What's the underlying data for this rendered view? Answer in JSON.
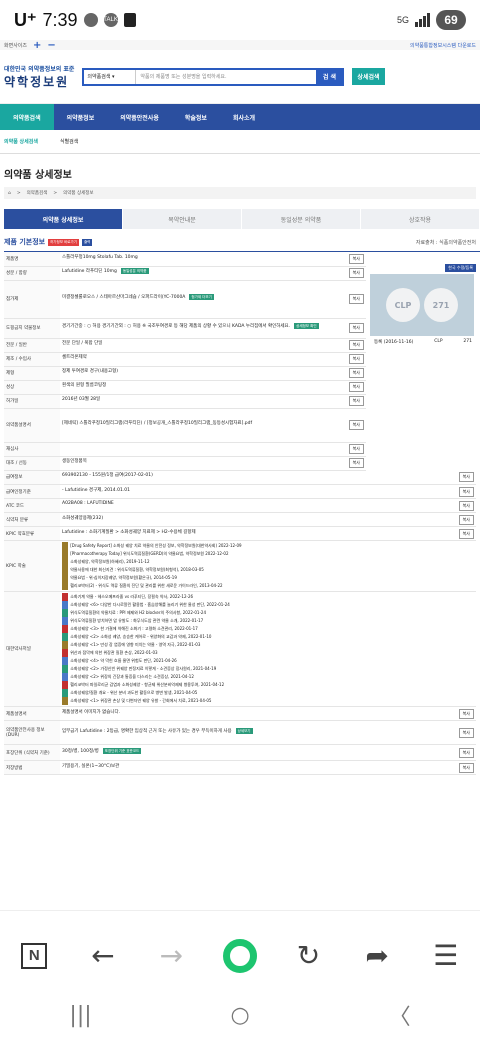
{
  "status": {
    "carrier": "U⁺",
    "time": "7:39",
    "badge": "TALK",
    "net": "5G",
    "battery": "69"
  },
  "browser": {
    "tab": "화면사이즈",
    "plus": "+",
    "minus": "−",
    "right": "의약품통합정보시스템 다운로드"
  },
  "header": {
    "slogan": "대한민국 의약품정보의 표준",
    "title": "약학정보원",
    "search_select": "의약품검색 ▾",
    "search_placeholder": "약품의 제품명 또는 성분명을 입력하세요.",
    "search_btn": "검 색",
    "detail_btn": "상세검색"
  },
  "gnb": [
    "의약품검색",
    "의약품정보",
    "의약품안전사용",
    "학술정보",
    "회사소개"
  ],
  "subnav": [
    "의약품 상세검색",
    "식별검색"
  ],
  "page_title": "의약품 상세정보",
  "breadcrumb": [
    "⌂",
    ">",
    "의약품검색",
    ">",
    "의약품 상세정보"
  ],
  "tabs": [
    "의약품 상세정보",
    "복약안내문",
    "동일성분 의약품",
    "상호작용"
  ],
  "section": {
    "title": "제품 기본정보",
    "badge1": "허가정보 바로가기",
    "badge2": "출력",
    "source": "자료출처 : 식품의약품안전처"
  },
  "view_label": "복사",
  "rows": [
    {
      "h": "제품명",
      "v": "스톨라푸정10mg Stolafu Tab. 10mg"
    },
    {
      "h": "성분 / 함량",
      "v": "Lafutidine  라푸티딘  10mg",
      "extra": "동일성분 의약품"
    },
    {
      "h": "첨가제",
      "v": "미결정셀룰로오스 / 스테아르산마그네슘 / 오파드라이(YC-7000A",
      "extra": "첨가제 더보기"
    },
    {
      "h": "도핑금지 약물정보",
      "v": "경기기간중 : ○ 허용   경기기간외 : ○ 허용  ※ 국조투여경로 등 해당 제품의 상황 수 있으니 KADA 누리집에서 확인하세요.",
      "extra": "상세정보 확인"
    },
    {
      "h": "전문 / 일반",
      "v": "전문   단일 / 복합   단일"
    },
    {
      "h": "제조 / 수입사",
      "v": "셀트리온제약"
    },
    {
      "h": "제형",
      "v": "정제   투여경로   경구(내용고형)"
    },
    {
      "h": "성상",
      "v": "흰색의 원형 필름코팅정"
    },
    {
      "h": "허가일",
      "v": "2016년 03월 28일"
    },
    {
      "h": "의약품설명서",
      "v": "[제네릭] 스톨라푸정10밀리그램(라푸티딘) / [정보공개_스톨라푸정10밀리그램_동등성시험자료].pdf"
    },
    {
      "h": "재심사",
      "v": ""
    },
    {
      "h": "대조 / 선동",
      "v": "생동인정품목"
    },
    {
      "h": "급여정보",
      "v": "693902130 - 155원/1정 급여(2017-02-01)"
    },
    {
      "h": "급여인정기준",
      "v": "- Lafutidine 경구제, 2014.01.01"
    },
    {
      "h": "ATC 코드",
      "v": "A02BA08 : LAFUTIDINE"
    },
    {
      "h": "식약처 분류",
      "v": "소화성궤양용제(232)"
    },
    {
      "h": "KPIC 약효분류",
      "v": "Lafutidine : 소화기계질환 > 소화성궤양 치료제 > H2-수용체 길항제"
    }
  ],
  "kpic": [
    "[Drug Safety Report] 소화성 궤양 치료 약물의 안전성 정보, 약학정보원(대한약사회) 2022-12-09",
    "[Pharmacotherapy Today] 위식도역류질환(GERD)의 약물요법, 약학정보원 2022-12-02",
    "소화성궤양, 약학정보원(하혜리), 2019-11-12",
    "약물사용에 대한 최신지견 : 위식도역류질환, 약학정보원(최형석), 2018-03-05",
    "약물요법 - 위·십이지장궤양, 약학정보원(황은규), 2014-05-19",
    "헬리코박터(2) - 위식도 역류 질환의 진단 및 관리를 위한 새로운 가이드라인, 2013-04-22"
  ],
  "news": [
    "소화기계 약물 - 헤스오메프라졸 vs 라푸티딘, 장필숙 약사, 2022-12-26",
    "소화성궤양 <6> 다양한 다시로알린 활용법 - 흡습양해를 늘리기 위한 물성 판단, 2022-01-24",
    "위식도역류질환의 약물치료 : PPI 제제와 H2 blocker의 주의사항, 2022-01-24",
    "위식도역류질환 방치하면 암 유발도 : 화무식도암 관련 약물 소개, 2022-01-17",
    "소화성궤양 <3> 한 가결에 약해진 소화기 : 고령화 소견관리, 2022-01-17",
    "소화성궤양 <2> 소화성 궤양, 승승한 케어로 - 위양화의 교감과 약제, 2022-01-10",
    "소화성궤양 <1> 만성 장 염증에 영향 미치는 약물 - 영역 자극, 2022-01-03",
    "위산과 점막에 의한 위장관 질환 손상, 2022-01-03",
    "소화성궤양 <4> 약 막힌 흐름 물면 위험도 판단, 2021-04-26",
    "소화성궤양 <2> 가정신빈 위궤양 판정지료 이렇게 - 소견증상 장사원리, 2021-04-19",
    "소화성궤양 <2> 위장의 긴장과 통증을 다스리는 소견증상, 2021-04-12",
    "헬리코박터 파일로리균 감염과 소화성궤양 - 항균제 위산분비억제제 병용투여, 2021-04-12",
    "소화성궤양/질환 개요 - 위산 분비 과도한 활동으로 병변 발생, 2021-04-05",
    "소화성궤양 <1> 위장관 손상 및 다변자연 궤양 유발 - 간회에서 치료, 2021-04-05"
  ],
  "rows2": [
    {
      "h": "제품설명서",
      "v": "제품설명서 이미지가 없습니다."
    },
    {
      "h": "의약품안전사용 정보(DUR)",
      "v": "임부금기 Lafutidine : 2등급, 명확한 임상적 근거 또는 사유가 있는 경우 부득이하게 사용",
      "extra": "상세보기"
    },
    {
      "h": "포장단위 (식약처 기준)",
      "v": "30정/병, 100정/병",
      "extra": "포장단위 기준 표준코드"
    },
    {
      "h": "저장방법",
      "v": "기밀용기, 실온(1~30°C)보관"
    }
  ],
  "kpic_label": "KPIC 학술",
  "news_label": "대한약사저널",
  "side": {
    "btn": "한국 수정/등록",
    "imgtext1": "CLP",
    "imgtext2": "271",
    "date": "등록 (2016-11-16)",
    "label1": "CLP",
    "label2": "271"
  },
  "nav": {
    "n": "N",
    "back": "←",
    "forward": "→",
    "reload": "↻",
    "share": "➦",
    "menu": "☰"
  },
  "sys": {
    "recent": "|||",
    "home": "○",
    "back": "〈"
  }
}
